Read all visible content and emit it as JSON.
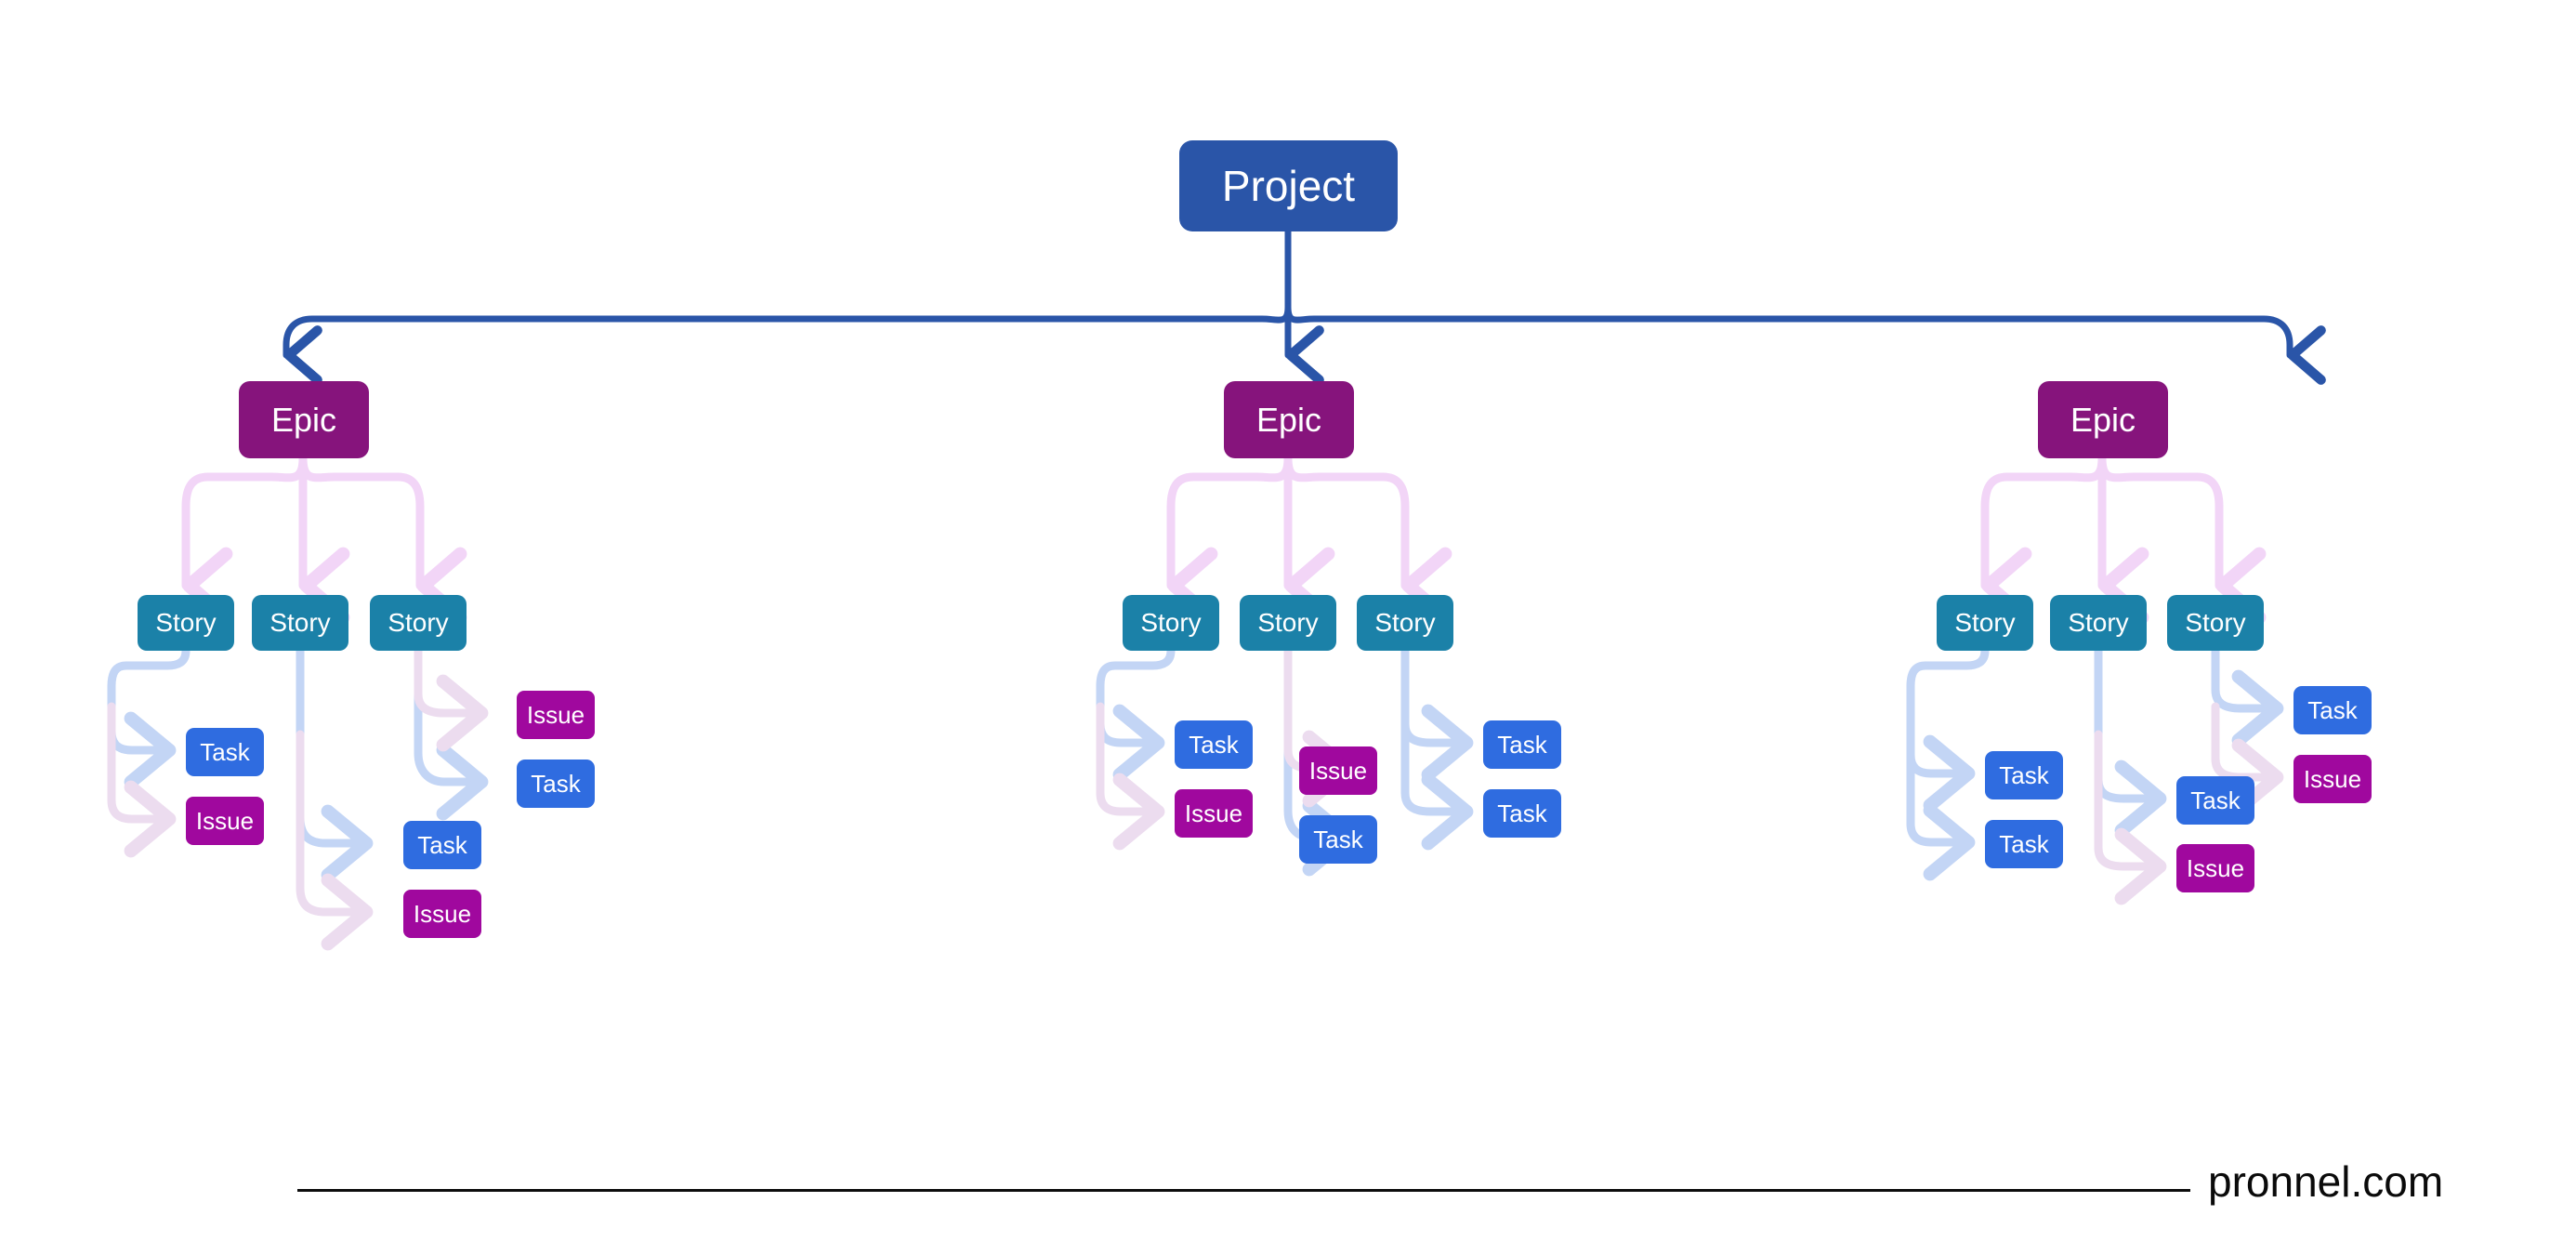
{
  "diagram": {
    "title_node": {
      "label": "Project",
      "color": "#2a55a8"
    },
    "legend_colors": {
      "project": "#2a55a8",
      "epic": "#86147c",
      "story": "#1b81a8",
      "task": "#2f6ce0",
      "issue": "#a0089e",
      "connector_project": "#2a55a8",
      "connector_epic": "#f2d5f7",
      "connector_task": "#c3d5f5",
      "connector_issue": "#ecdcef",
      "background": "#ffffff",
      "footer_text": "#0a0a0a"
    },
    "epics": [
      {
        "label": "Epic",
        "stories": [
          {
            "label": "Story",
            "children": [
              {
                "label": "Task",
                "kind": "task"
              },
              {
                "label": "Issue",
                "kind": "issue"
              }
            ]
          },
          {
            "label": "Story",
            "children": [
              {
                "label": "Task",
                "kind": "task"
              },
              {
                "label": "Issue",
                "kind": "issue"
              }
            ]
          },
          {
            "label": "Story",
            "children": [
              {
                "label": "Issue",
                "kind": "issue"
              },
              {
                "label": "Task",
                "kind": "task"
              }
            ]
          }
        ]
      },
      {
        "label": "Epic",
        "stories": [
          {
            "label": "Story",
            "children": [
              {
                "label": "Task",
                "kind": "task"
              },
              {
                "label": "Issue",
                "kind": "issue"
              }
            ]
          },
          {
            "label": "Story",
            "children": [
              {
                "label": "Issue",
                "kind": "issue"
              },
              {
                "label": "Task",
                "kind": "task"
              }
            ]
          },
          {
            "label": "Story",
            "children": [
              {
                "label": "Task",
                "kind": "task"
              },
              {
                "label": "Task",
                "kind": "task"
              }
            ]
          }
        ]
      },
      {
        "label": "Epic",
        "stories": [
          {
            "label": "Story",
            "children": [
              {
                "label": "Task",
                "kind": "task"
              },
              {
                "label": "Task",
                "kind": "task"
              }
            ]
          },
          {
            "label": "Story",
            "children": [
              {
                "label": "Task",
                "kind": "task"
              },
              {
                "label": "Issue",
                "kind": "issue"
              }
            ]
          },
          {
            "label": "Story",
            "children": [
              {
                "label": "Task",
                "kind": "task"
              },
              {
                "label": "Issue",
                "kind": "issue"
              }
            ]
          }
        ]
      }
    ]
  },
  "footer": {
    "site": "pronnel.com"
  }
}
